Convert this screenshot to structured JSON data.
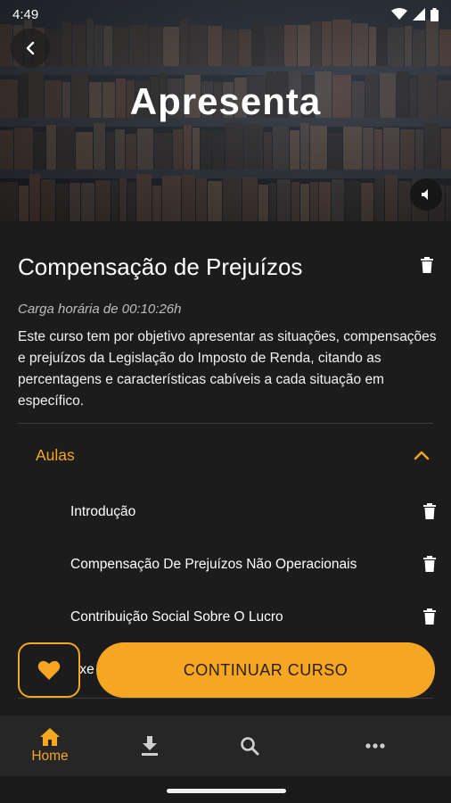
{
  "status_bar": {
    "time": "4:49",
    "icons": [
      "wifi-icon",
      "signal-icon",
      "battery-icon"
    ]
  },
  "hero": {
    "title": "Apresenta",
    "back_icon": "chevron-left-icon",
    "sound_icon": "volume-icon"
  },
  "course": {
    "title": "Compensação de Prejuízos",
    "workload": "Carga horária de 00:10:26h",
    "description": "Este curso tem por objetivo apresentar as situações, compensações e prejuízos da Legislação do Imposto de Renda, citando as percentagens e características cabíveis a cada situação em específico.",
    "delete_icon": "trash-icon"
  },
  "lessons_section": {
    "label": "Aulas",
    "expanded": true,
    "lessons": [
      {
        "label": "Introdução"
      },
      {
        "label": "Compensação De Prejuízos Não Operacionais"
      },
      {
        "label": "Contribuição Social Sobre O Lucro"
      },
      {
        "label": "Exe"
      }
    ]
  },
  "actions": {
    "favorite_icon": "heart-icon",
    "continue_label": "CONTINUAR CURSO"
  },
  "bottom_nav": {
    "items": [
      {
        "label": "Home",
        "icon": "home-icon",
        "active": true
      },
      {
        "label": "",
        "icon": "download-icon",
        "active": false
      },
      {
        "label": "",
        "icon": "search-icon",
        "active": false
      },
      {
        "label": "",
        "icon": "more-icon",
        "active": false
      }
    ]
  },
  "colors": {
    "accent": "#f5a623",
    "background": "#1c1c1c",
    "nav_background": "#262626"
  }
}
